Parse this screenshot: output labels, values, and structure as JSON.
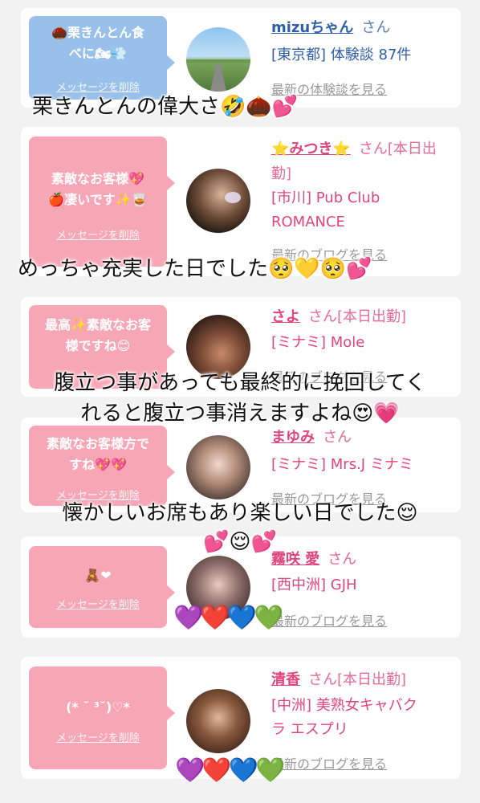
{
  "cards": [
    {
      "message": "🌰栗きんとん食べに🏍💨",
      "delete_label": "メッセージを削除",
      "name": "mizuちゃん",
      "suffix": "さん",
      "line2": "[東京都] 体験談 87件",
      "line3": "",
      "link": "最新の体験談を見る",
      "color": "#98c0ea"
    },
    {
      "message": "素敵なお客様💖🍎凄いです✨🥃",
      "delete_label": "メッセージを削除",
      "name": "⭐みつき⭐",
      "suffix": "さん[本日出勤]",
      "line2": "[市川] Pub Club",
      "line3": "ROMANCE",
      "link": "最新のブログを見る",
      "color": "#f7a6b6"
    },
    {
      "message": "最高✨素敵なお客様ですね😊",
      "delete_label": "メッセージを削除",
      "name": "さよ",
      "suffix": "さん[本日出勤]",
      "line2": "[ミナミ] Mole",
      "line3": "",
      "link": "最新のブログを見る",
      "color": "#f7a6b6"
    },
    {
      "message": "素敵なお客様方ですね💖💖",
      "delete_label": "メッセージを削除",
      "name": "まゆみ",
      "suffix": "さん",
      "line2": "[ミナミ] Mrs.J ミナミ",
      "line3": "",
      "link": "最新のブログを見る",
      "color": "#f7a6b6"
    },
    {
      "message": "🧸❤",
      "delete_label": "メッセージを削除",
      "name": "霧咲 愛",
      "suffix": "さん",
      "line2": "[西中洲] GJH",
      "line3": "",
      "link": "最新のブログを見る",
      "color": "#f7a6b6"
    },
    {
      "message": "(* ˘ ³˘)♡*",
      "delete_label": "メッセージを削除",
      "name": "清香",
      "suffix": "さん[本日出勤]",
      "line2": "[中洲] 美熟女キャバク",
      "line3": "ラ エスプリ",
      "link": "最新のブログを見る",
      "color": "#f7a6b6"
    }
  ],
  "overlays": {
    "o1": "栗きんとんの偉大さ🤣🌰💕",
    "o2": "めっちゃ充実した日でした🥺💛🥺💕",
    "o3a": "腹立つ事があっても最終的に挽回してく",
    "o3b": "れると腹立つ事消えますよね😍💗",
    "o4a": "懐かしいお席もあり楽しい日でした😌",
    "o4b": "💕😌💕",
    "hearts1": "💜❤️💙💚",
    "hearts2": "💜❤️💙💚"
  }
}
